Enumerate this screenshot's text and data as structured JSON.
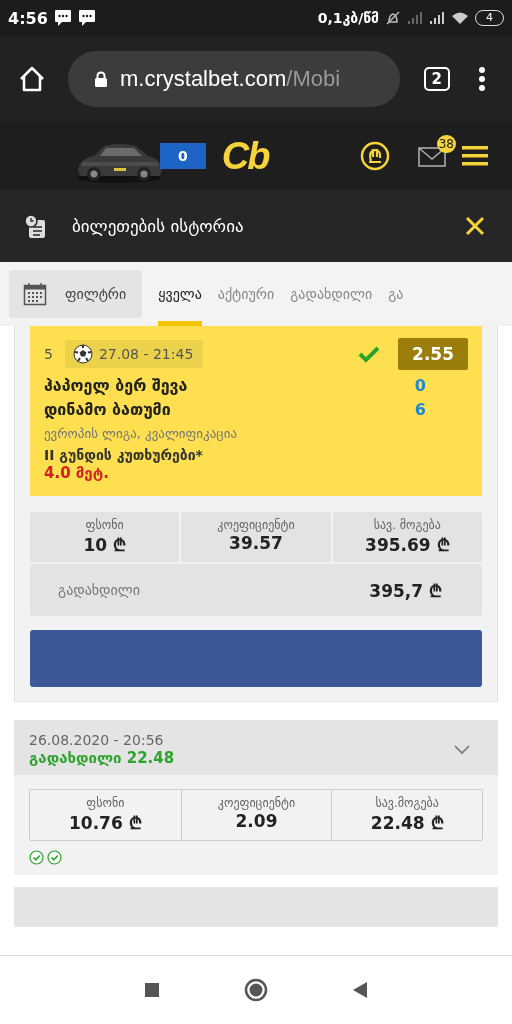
{
  "status_bar": {
    "time": "4:56",
    "speed": "0,1კბ/წმ",
    "battery": "4"
  },
  "browser": {
    "url_host": "m.crystalbet.com",
    "url_path": "/Mobi",
    "tab_count": "2"
  },
  "app_header": {
    "ticket_count": "0",
    "logo": "Cb",
    "mail_badge": "38"
  },
  "page_title": "ბილეთების ისტორია",
  "filter_button": "ფილტრი",
  "tabs": [
    {
      "label": "ყველა",
      "selected": true
    },
    {
      "label": "აქტიური",
      "selected": false
    },
    {
      "label": "გადახდილი",
      "selected": false
    },
    {
      "label": "გა",
      "selected": false
    }
  ],
  "open_ticket": {
    "event": {
      "number": "5",
      "datetime": "27.08 - 21:45",
      "won": true,
      "odds": "2.55",
      "team_home": "ჰაპოელ ბერ შევა",
      "team_away": "დინამო ბათუმი",
      "score_home": "0",
      "score_away": "6",
      "league": "ევროპის ლიგა, კვალიფიკაცია",
      "market": "II გუნდის კუთხურები*",
      "pick": "4.0 მეტ."
    },
    "stats": [
      {
        "label": "ფსონი",
        "value": "10 ₾"
      },
      {
        "label": "კოეფიციენტი",
        "value": "39.57"
      },
      {
        "label": "სავ. მოგება",
        "value": "395.69 ₾"
      }
    ],
    "paid_label": "გადახდილი",
    "paid_value": "395,7 ₾"
  },
  "tickets": [
    {
      "datetime": "26.08.2020 - 20:56",
      "result": "გადახდილი 22.48",
      "expanded": false,
      "stats": [
        {
          "label": "ფსონი",
          "value": "10.76 ₾"
        },
        {
          "label": "კოეფიციენტი",
          "value": "2.09"
        },
        {
          "label": "სავ.მოგება",
          "value": "22.48 ₾"
        }
      ],
      "legs": [
        {
          "won": true
        },
        {
          "won": true
        }
      ]
    }
  ]
}
